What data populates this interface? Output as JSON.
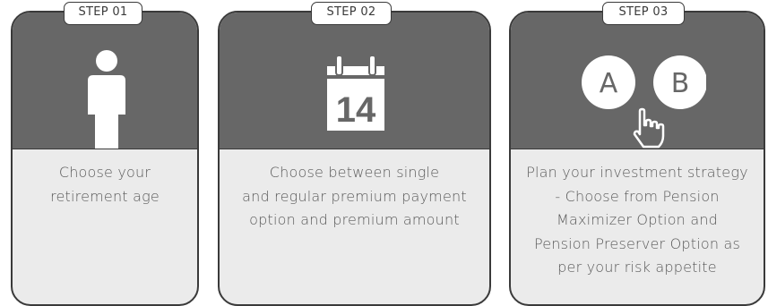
{
  "steps": [
    {
      "badge": "STEP 01",
      "icon": "person-icon",
      "lines": [
        "Choose your",
        "retirement age"
      ]
    },
    {
      "badge": "STEP 02",
      "icon": "calendar-icon",
      "calendar_day": "14",
      "lines": [
        "Choose between single",
        "and regular premium payment",
        "option and premium amount"
      ]
    },
    {
      "badge": "STEP 03",
      "icon": "ab-choice-icon",
      "option_a": "A",
      "option_b": "B",
      "lines": [
        "Plan your investment strategy",
        "- Choose from Pension",
        "Maximizer Option and",
        "Pension Preserver Option as",
        "per your risk appetite"
      ]
    }
  ],
  "colors": {
    "panel": "#676767",
    "body": "#ebebeb",
    "border": "#3a3a3a",
    "text": "#5a5a5a"
  }
}
